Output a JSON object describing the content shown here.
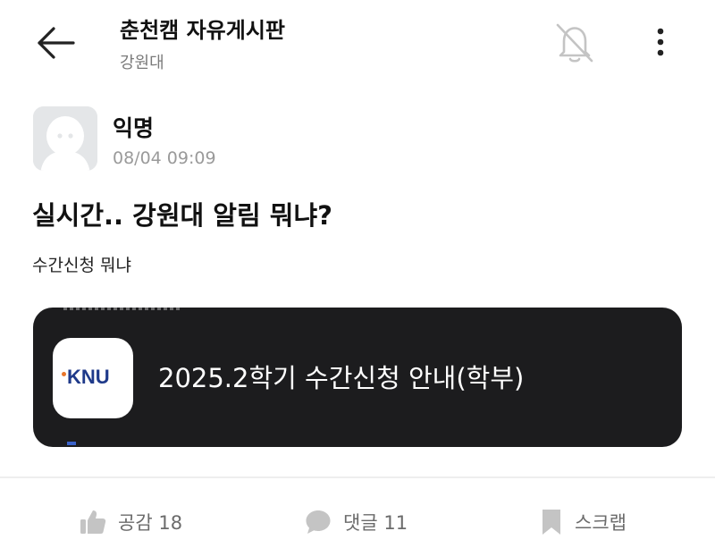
{
  "header": {
    "title": "춘천캠 자유게시판",
    "subtitle": "강원대",
    "back_icon": "arrow-left-icon",
    "bell_icon": "bell-off-icon",
    "more_icon": "more-vertical-icon"
  },
  "post": {
    "author": "익명",
    "timestamp": "08/04 09:09",
    "title": "실시간.. 강원대 알림 뭐냐?",
    "body": "수간신청 뭐냐"
  },
  "notification_card": {
    "app_logo_text": "KNU",
    "text": "2025.2학기 수간신청 안내(학부)"
  },
  "actions": {
    "like": {
      "label": "공감",
      "count": "18",
      "icon": "thumbs-up-icon"
    },
    "comment": {
      "label": "댓글",
      "count": "11",
      "icon": "speech-bubble-icon"
    },
    "scrap": {
      "label": "스크랩",
      "icon": "bookmark-icon"
    }
  },
  "colors": {
    "card_background": "#1c1c1e",
    "logo_blue": "#1f3a8a",
    "logo_orange": "#e8762b",
    "muted_text": "#9a9a9a",
    "icon_gray": "#c4c4c4"
  }
}
